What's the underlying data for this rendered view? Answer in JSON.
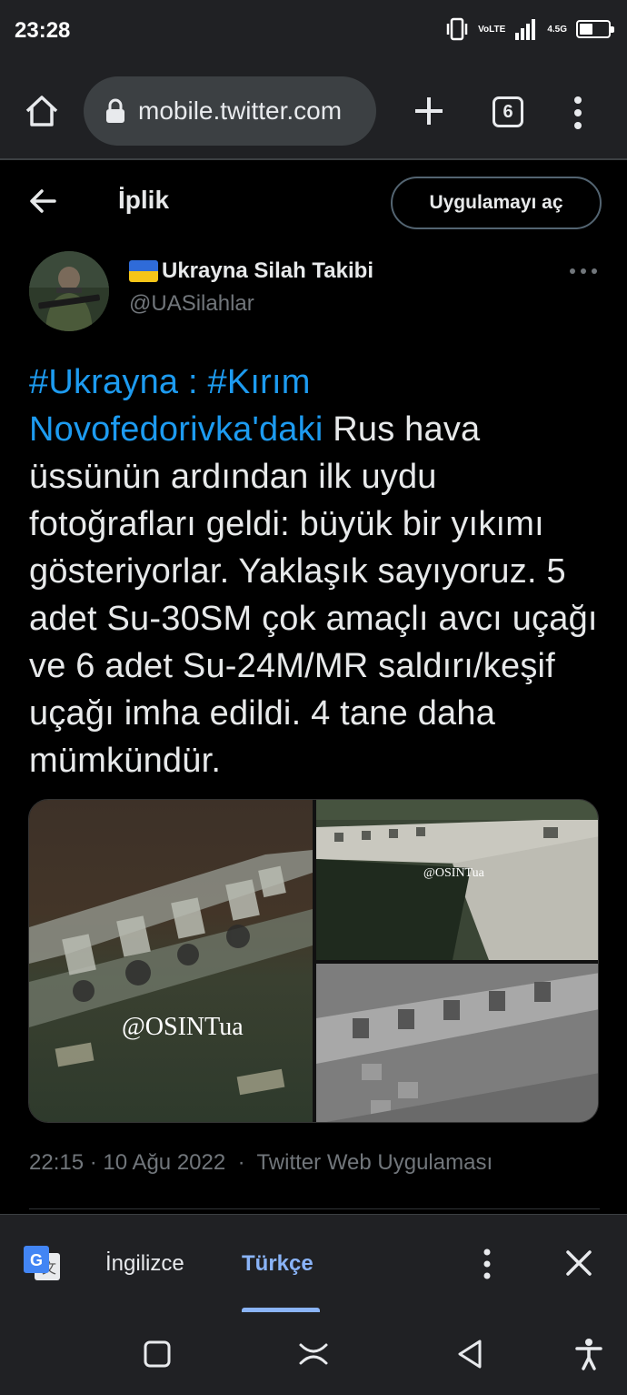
{
  "status_bar": {
    "time": "23:28",
    "network_label": "VoLTE",
    "network_type": "4.5G",
    "icons": [
      "vibrate-icon",
      "volte-icon",
      "signal-icon",
      "network-4-5g-icon",
      "battery-icon"
    ]
  },
  "browser": {
    "url": "mobile.twitter.com",
    "tab_count": "6",
    "icons": [
      "home-icon",
      "lock-icon",
      "new-tab-icon",
      "tab-switcher-icon",
      "overflow-menu-icon"
    ]
  },
  "header": {
    "title": "İplik",
    "open_app_label": "Uygulamayı aç"
  },
  "tweet": {
    "author_name": "Ukrayna Silah Takibi",
    "author_handle": "@UASilahlar",
    "hashtag1": "#Ukrayna",
    "separator": " : ",
    "hashtag2": "#Kırım",
    "link_place": "Novofedorivka'daki",
    "body": " Rus hava üssünün ardından ilk uydu fotoğrafları geldi: büyük bir yıkımı gösteriyorlar. Yaklaşık sayıyoruz. 5 adet Su-30SM çok amaçlı avcı uçağı ve 6 adet Su-24M/MR saldırı/keşif uçağı imha edildi. 4 tane daha mümkündür.",
    "images": [
      {
        "watermark": "@OSINTua"
      },
      {
        "watermark": "@OSINTua"
      },
      {
        "watermark": ""
      }
    ],
    "time": "22:15",
    "date": "10 Ağu 2022",
    "dot": "·",
    "source": "Twitter Web Uygulaması"
  },
  "translate_bar": {
    "source_lang": "İngilizce",
    "target_lang": "Türkçe"
  },
  "colors": {
    "link": "#1d9bf0",
    "background": "#000000",
    "chrome_bar": "#202124",
    "active_lang": "#8ab4f8"
  }
}
